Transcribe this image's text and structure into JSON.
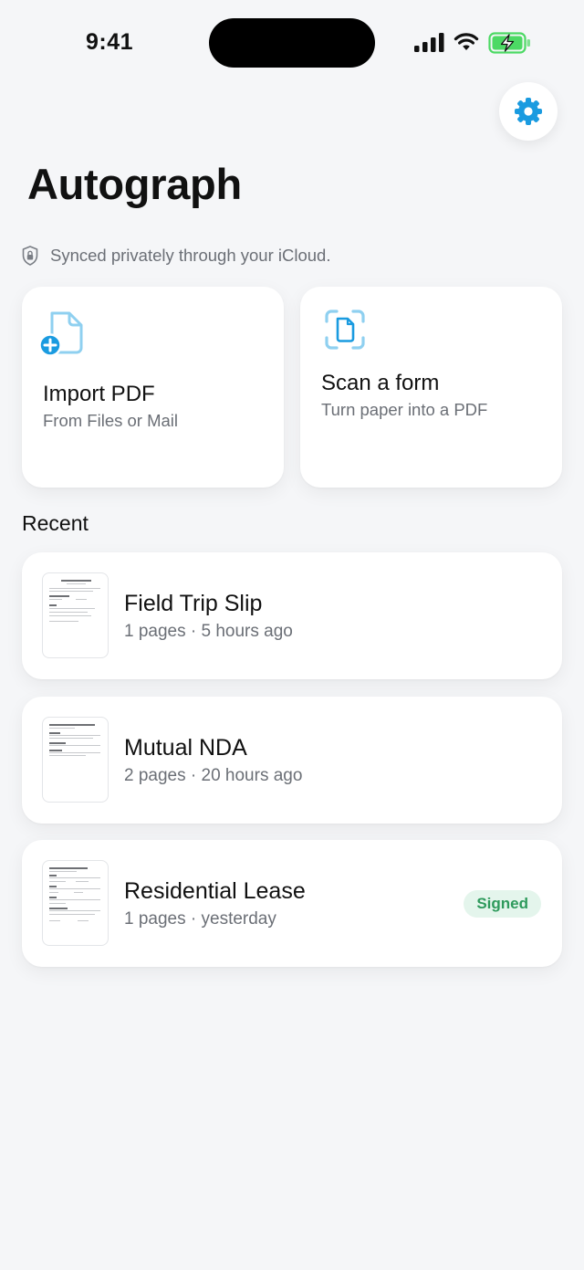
{
  "status_bar": {
    "time": "9:41",
    "icons": [
      "signal-bars-icon",
      "wifi-icon",
      "battery-charging-icon"
    ]
  },
  "header": {
    "settings_icon": "gear-icon",
    "title": "Autograph",
    "sync_note": "Synced privately through your iCloud.",
    "sync_icon": "lock-icon"
  },
  "actions": [
    {
      "title": "Import PDF",
      "subtitle": "From Files or Mail",
      "icon": "document-plus-icon"
    },
    {
      "title": "Scan a form",
      "subtitle": "Turn paper into a PDF",
      "icon": "document-scan-icon"
    }
  ],
  "recent": {
    "heading": "Recent",
    "documents": [
      {
        "title": "Field Trip Slip",
        "meta": "1 pages · 5 hours ago",
        "badge": null
      },
      {
        "title": "Mutual NDA",
        "meta": "2 pages · 20 hours ago",
        "badge": null
      },
      {
        "title": "Residential Lease",
        "meta": "1 pages · yesterday",
        "badge": "Signed"
      }
    ]
  },
  "colors": {
    "accent": "#1a9be0",
    "icon_light": "#8fd0f0",
    "background": "#f5f6f8",
    "badge_bg": "#e4f5ec",
    "badge_text": "#2e9a5c",
    "battery_green": "#4cd964"
  }
}
